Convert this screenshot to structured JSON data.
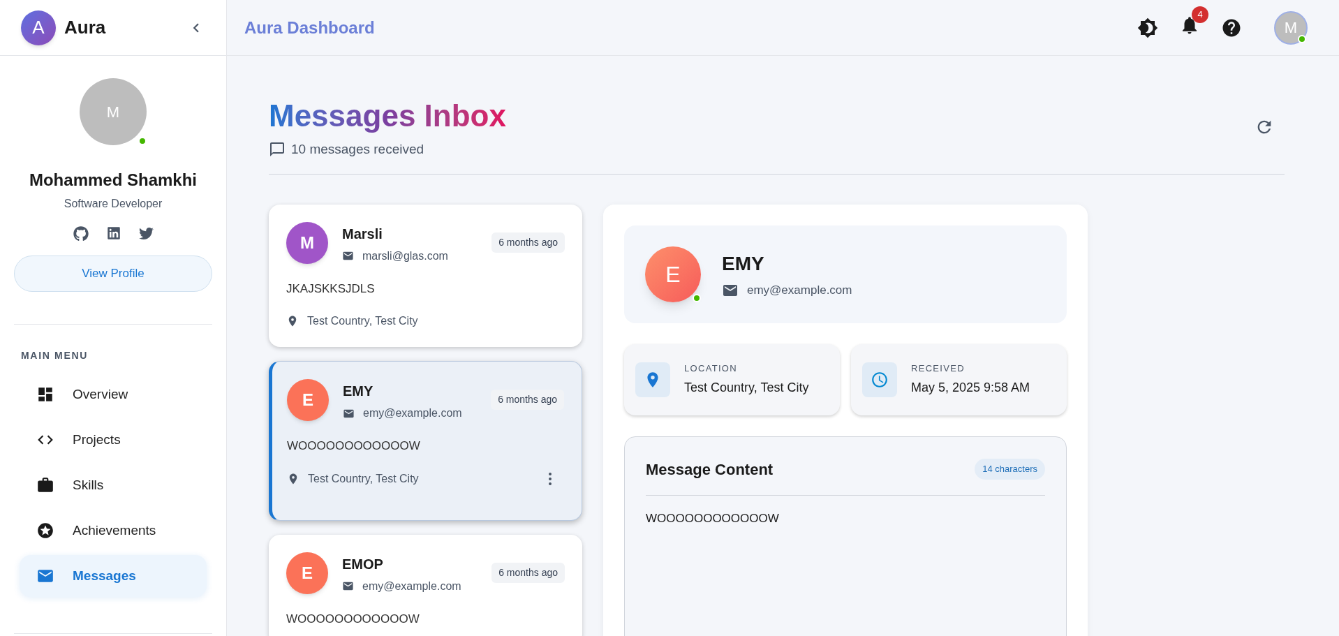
{
  "sidebar": {
    "logo": {
      "letter": "A",
      "name": "Aura"
    },
    "profile": {
      "initial": "M",
      "online": true,
      "name": "Mohammed Shamkhi",
      "role": "Software Developer",
      "button": "View Profile"
    },
    "menu_title": "MAIN MENU",
    "menu": [
      {
        "label": "Overview",
        "selected": false
      },
      {
        "label": "Projects",
        "selected": false
      },
      {
        "label": "Skills",
        "selected": false
      },
      {
        "label": "Achievements",
        "selected": false
      },
      {
        "label": "Messages",
        "selected": true
      }
    ]
  },
  "header": {
    "title": "Aura Dashboard",
    "notifications": "4",
    "avatar": {
      "initial": "M",
      "online": true
    }
  },
  "page": {
    "title": "Messages Inbox",
    "subtitle": "10 messages received"
  },
  "messages": [
    {
      "initial": "M",
      "color": "#a055c8",
      "name": "Marsli",
      "email": "marsli@glas.com",
      "time": "6 months ago",
      "text": "JKAJSKKSJDLS",
      "location": "Test Country, Test City",
      "selected": false
    },
    {
      "initial": "E",
      "color": "#fb7258",
      "name": "EMY",
      "email": "emy@example.com",
      "time": "6 months ago",
      "text": "WOOOOOOOOOOOOW",
      "location": "Test Country, Test City",
      "selected": true
    },
    {
      "initial": "E",
      "color": "#fb7258",
      "name": "EMOP",
      "email": "emy@example.com",
      "time": "6 months ago",
      "text": "WOOOOOOOOOOOOW",
      "selected": false
    }
  ],
  "detail": {
    "initial": "E",
    "online": true,
    "name": "EMY",
    "email": "emy@example.com",
    "info": [
      {
        "label": "LOCATION",
        "value": "Test Country, Test City"
      },
      {
        "label": "RECEIVED",
        "value": "May 5, 2025 9:58 AM"
      }
    ],
    "content_title": "Message Content",
    "char_count": "14 characters",
    "content": "WOOOOOOOOOOOOW"
  }
}
